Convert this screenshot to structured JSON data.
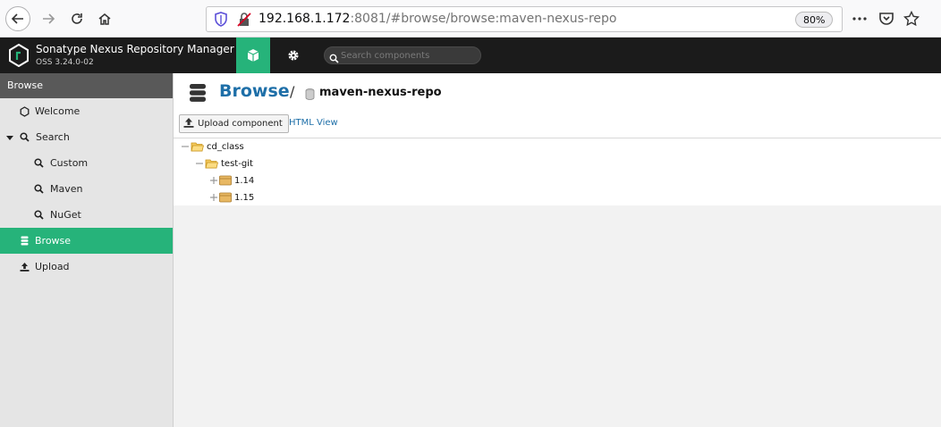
{
  "browser": {
    "url_host": "192.168.1.172",
    "url_rest": ":8081/#browse/browse:maven-nexus-repo",
    "zoom": "80%"
  },
  "app": {
    "title": "Sonatype Nexus Repository Manager",
    "version": "OSS 3.24.0-02",
    "search_placeholder": "Search components"
  },
  "sidebar": {
    "header": "Browse",
    "items": [
      {
        "label": "Welcome",
        "icon": "hexagon-icon"
      },
      {
        "label": "Search",
        "icon": "search-icon"
      },
      {
        "label": "Custom",
        "icon": "search-icon"
      },
      {
        "label": "Maven",
        "icon": "search-icon"
      },
      {
        "label": "NuGet",
        "icon": "search-icon"
      },
      {
        "label": "Browse",
        "icon": "database-icon",
        "active": true
      },
      {
        "label": "Upload",
        "icon": "upload-icon"
      }
    ]
  },
  "main": {
    "title": "Browse",
    "separator": "/",
    "repo": "maven-nexus-repo",
    "upload_label": "Upload component",
    "html_view_label": "HTML View",
    "tree": [
      {
        "label": "cd_class",
        "type": "folder"
      },
      {
        "label": "test-git",
        "type": "folder"
      },
      {
        "label": "1.14",
        "type": "component"
      },
      {
        "label": "1.15",
        "type": "component"
      }
    ]
  },
  "colors": {
    "accent": "#26b37a",
    "header_bg": "#1b1b1b",
    "link": "#1e6fa8"
  }
}
